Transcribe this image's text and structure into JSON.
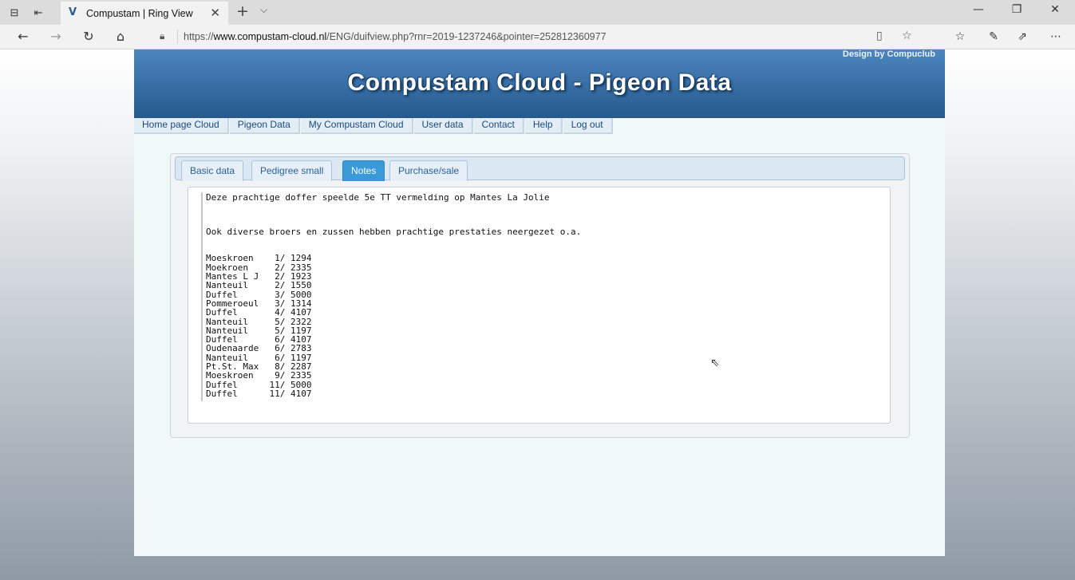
{
  "browser": {
    "tab": {
      "title": "Compustam | Ring View",
      "favicon": "V"
    },
    "url": {
      "prefix": "https://",
      "domain": "www.compustam-cloud.nl",
      "path": "/ENG/duifview.php?rnr=2019-1237246&pointer=252812360977"
    }
  },
  "site": {
    "credit": "Design by Compuclub",
    "title": "Compustam Cloud - Pigeon Data",
    "menu": [
      "Home page Cloud",
      "Pigeon Data",
      "My Compustam Cloud",
      "User data",
      "Contact",
      "Help",
      "Log out"
    ]
  },
  "tabs": [
    {
      "label": "Basic data",
      "active": false
    },
    {
      "label": "Pedigree small",
      "active": false
    },
    {
      "label": "Notes",
      "active": true
    },
    {
      "label": "Purchase/sale",
      "active": false
    }
  ],
  "notes": {
    "line1": "Deze prachtige doffer speelde 5e TT vermelding op Mantes La Jolie",
    "line2": "Ook diverse broers en zussen hebben prachtige prestaties neergezet o.a.",
    "results": [
      {
        "place": "Moeskroen",
        "rank": "1",
        "total": "1294"
      },
      {
        "place": "Moekroen",
        "rank": "2",
        "total": "2335"
      },
      {
        "place": "Mantes L J",
        "rank": "2",
        "total": "1923"
      },
      {
        "place": "Nanteuil",
        "rank": "2",
        "total": "1550"
      },
      {
        "place": "Duffel",
        "rank": "3",
        "total": "5000"
      },
      {
        "place": "Pommeroeul",
        "rank": "3",
        "total": "1314"
      },
      {
        "place": "Duffel",
        "rank": "4",
        "total": "4107"
      },
      {
        "place": "Nanteuil",
        "rank": "5",
        "total": "2322"
      },
      {
        "place": "Nanteuil",
        "rank": "5",
        "total": "1197"
      },
      {
        "place": "Duffel",
        "rank": "6",
        "total": "4107"
      },
      {
        "place": "Oudenaarde",
        "rank": "6",
        "total": "2783"
      },
      {
        "place": "Nanteuil",
        "rank": "6",
        "total": "1197"
      },
      {
        "place": "Pt.St. Max",
        "rank": "8",
        "total": "2287"
      },
      {
        "place": "Moeskroen",
        "rank": "9",
        "total": "2335"
      },
      {
        "place": "Duffel",
        "rank": "11",
        "total": "5000"
      },
      {
        "place": "Duffel",
        "rank": "11",
        "total": "4107"
      }
    ]
  }
}
